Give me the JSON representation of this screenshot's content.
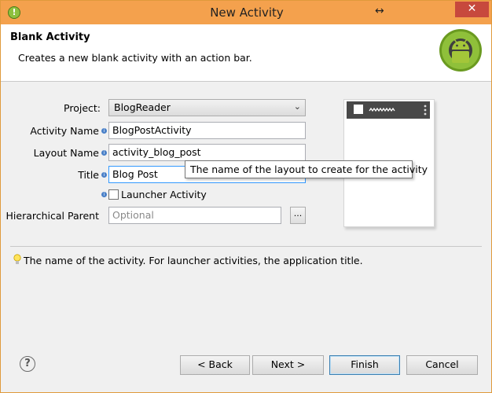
{
  "window": {
    "title": "New Activity",
    "resize_glyph": "↔",
    "close_label": "✕"
  },
  "header": {
    "title": "Blank Activity",
    "description": "Creates a new blank activity with an action bar."
  },
  "form": {
    "project_label": "Project:",
    "project_value": "BlogReader",
    "activity_name_label": "Activity Name",
    "activity_name_value": "BlogPostActivity",
    "layout_name_label": "Layout Name",
    "layout_name_value": "activity_blog_post",
    "title_label": "Title",
    "title_value": "Blog Post",
    "launcher_label": "Launcher Activity",
    "launcher_checked": false,
    "parent_label": "Hierarchical Parent",
    "parent_placeholder": "Optional",
    "browse_label": "..."
  },
  "tooltip": "The name of the layout to create for the activity",
  "hint": "The name of the activity. For launcher activities, the application title.",
  "buttons": {
    "back": "< Back",
    "next": "Next >",
    "finish": "Finish",
    "cancel": "Cancel",
    "help": "?"
  },
  "colors": {
    "titlebar": "#f4a14d",
    "close": "#c7493d",
    "android_green": "#a4c639",
    "info": "#4a80c8"
  }
}
